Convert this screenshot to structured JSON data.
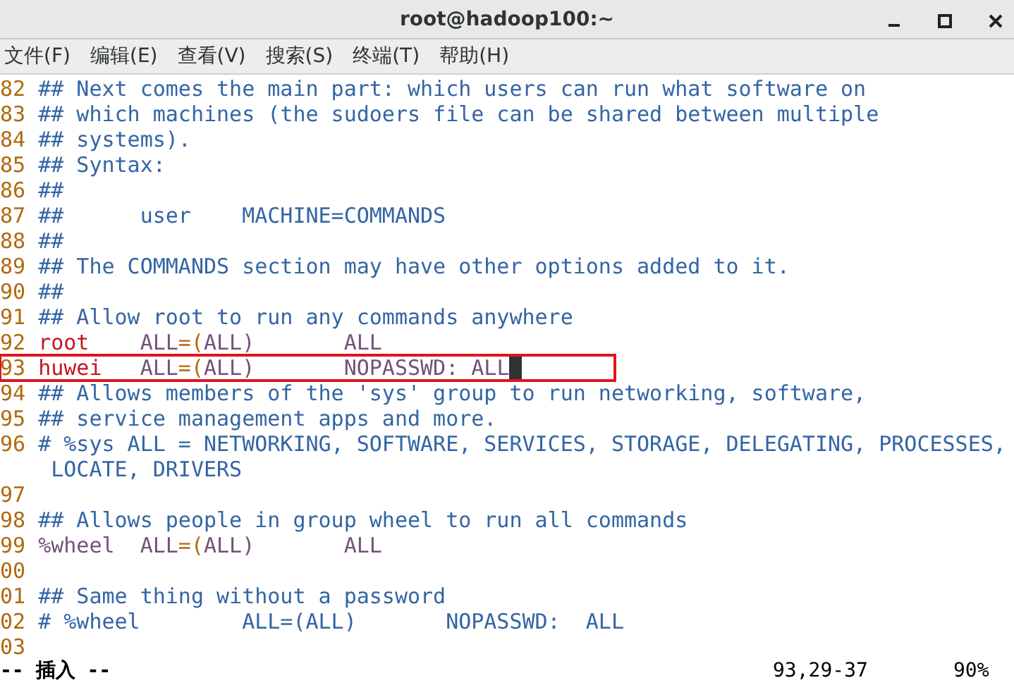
{
  "window": {
    "title": "root@hadoop100:~"
  },
  "menu": [
    "文件(F)",
    "编辑(E)",
    "查看(V)",
    "搜索(S)",
    "终端(T)",
    "帮助(H)"
  ],
  "editor": {
    "lines": [
      {
        "number": "82",
        "segments": [
          {
            "kind": "comment",
            "text": "## Next comes the main part: which users can run what software on"
          }
        ]
      },
      {
        "number": "83",
        "segments": [
          {
            "kind": "comment",
            "text": "## which machines (the sudoers file can be shared between multiple"
          }
        ]
      },
      {
        "number": "84",
        "segments": [
          {
            "kind": "comment",
            "text": "## systems)."
          }
        ]
      },
      {
        "number": "85",
        "segments": [
          {
            "kind": "comment",
            "text": "## Syntax:"
          }
        ]
      },
      {
        "number": "86",
        "segments": [
          {
            "kind": "comment",
            "text": "##"
          }
        ]
      },
      {
        "number": "87",
        "segments": [
          {
            "kind": "comment",
            "text": "##      user    MACHINE=COMMANDS"
          }
        ]
      },
      {
        "number": "88",
        "segments": [
          {
            "kind": "comment",
            "text": "##"
          }
        ]
      },
      {
        "number": "89",
        "segments": [
          {
            "kind": "comment",
            "text": "## The COMMANDS section may have other options added to it."
          }
        ]
      },
      {
        "number": "90",
        "segments": [
          {
            "kind": "comment",
            "text": "##"
          }
        ]
      },
      {
        "number": "91",
        "segments": [
          {
            "kind": "comment",
            "text": "## Allow root to run any commands anywhere"
          }
        ]
      },
      {
        "number": "92",
        "segments": [
          {
            "kind": "user",
            "text": "root    "
          },
          {
            "kind": "value",
            "text": "ALL"
          },
          {
            "kind": "op",
            "text": "=("
          },
          {
            "kind": "value",
            "text": "ALL)       ALL"
          }
        ]
      },
      {
        "number": "93",
        "highlighted": true,
        "cursor": true,
        "segments": [
          {
            "kind": "user",
            "text": "huwei   "
          },
          {
            "kind": "value",
            "text": "ALL"
          },
          {
            "kind": "op",
            "text": "=("
          },
          {
            "kind": "value",
            "text": "ALL)       NOPASSWD: ALL"
          }
        ]
      },
      {
        "number": "94",
        "segments": [
          {
            "kind": "comment",
            "text": "## Allows members of the 'sys' group to run networking, software,"
          }
        ]
      },
      {
        "number": "95",
        "segments": [
          {
            "kind": "comment",
            "text": "## service management apps and more."
          }
        ]
      },
      {
        "number": "96",
        "segments": [
          {
            "kind": "comment",
            "text": "# %sys ALL = NETWORKING, SOFTWARE, SERVICES, STORAGE, DELEGATING, PROCESSES,"
          }
        ]
      },
      {
        "segments": [
          {
            "kind": "comment",
            "text": " LOCATE, DRIVERS"
          }
        ]
      },
      {
        "number": "97"
      },
      {
        "number": "98",
        "segments": [
          {
            "kind": "comment",
            "text": "## Allows people in group wheel to run all commands"
          }
        ]
      },
      {
        "number": "99",
        "segments": [
          {
            "kind": "value",
            "text": "%wheel  ALL"
          },
          {
            "kind": "op",
            "text": "=("
          },
          {
            "kind": "value",
            "text": "ALL)       ALL"
          }
        ]
      },
      {
        "number": "00"
      },
      {
        "number": "01",
        "segments": [
          {
            "kind": "comment",
            "text": "## Same thing without a password"
          }
        ]
      },
      {
        "number": "02",
        "segments": [
          {
            "kind": "comment",
            "text": "# %wheel        ALL=(ALL)       NOPASSWD:  ALL"
          }
        ]
      },
      {
        "number": "03"
      }
    ]
  },
  "status_bar": {
    "mode": "-- 插入 --",
    "position": "93,29-37",
    "percent": "90%"
  }
}
